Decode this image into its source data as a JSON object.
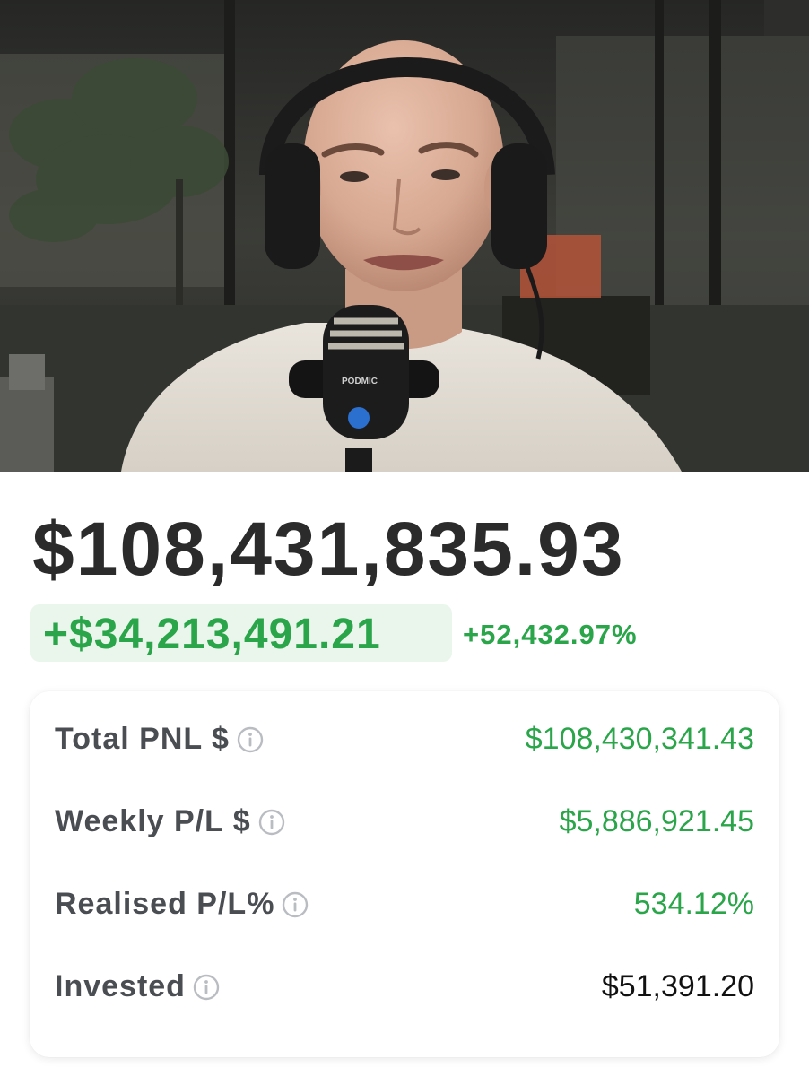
{
  "video": {
    "mic_brand": "PODMIC"
  },
  "portfolio": {
    "total_value": "$108,431,835.93",
    "change_amount": "+$34,213,491.21",
    "change_percent": "+52,432.97%"
  },
  "stats": {
    "total_pnl": {
      "label": "Total PNL $",
      "value": "$108,430,341.43",
      "icon": "info-icon"
    },
    "weekly_pl": {
      "label": "Weekly P/L $",
      "value": "$5,886,921.45",
      "icon": "info-icon"
    },
    "realised_pl": {
      "label": "Realised P/L%",
      "value": "534.12%",
      "icon": "info-icon"
    },
    "invested": {
      "label": "Invested",
      "value": "$51,391.20",
      "icon": "info-icon"
    }
  },
  "colors": {
    "positive": "#2aa54a",
    "positive_bg": "#eaf6ec",
    "text_dark": "#2b2b2b",
    "label_gray": "#4a4d52"
  }
}
